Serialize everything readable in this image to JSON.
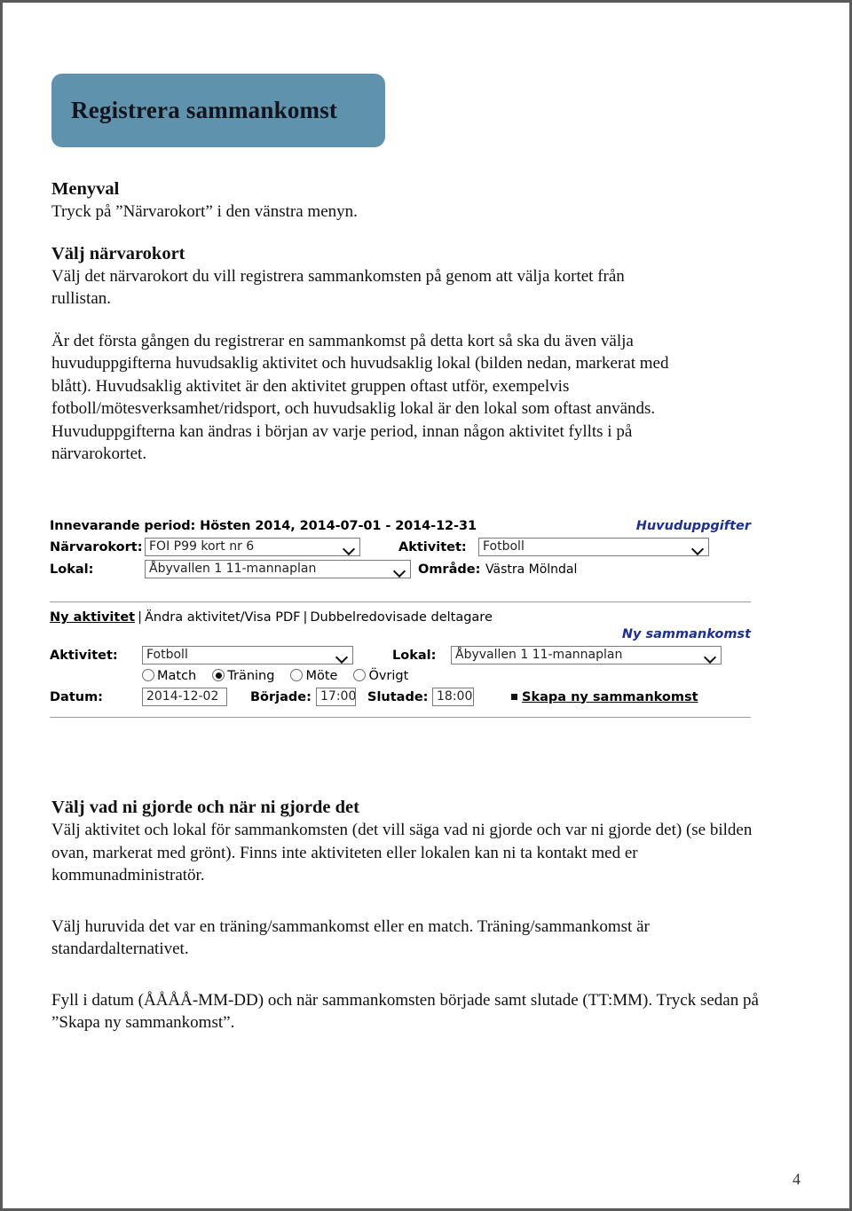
{
  "document": {
    "title_box": {
      "heading": "Registrera sammankomst",
      "bg_color": "#5f92ac"
    },
    "page_number": "4",
    "sections": [
      {
        "heading": "Menyval",
        "body": "Tryck på ”Närvarokort” i den vänstra menyn."
      },
      {
        "heading": "Välj närvarokort",
        "body": "Välj det närvarokort du vill registrera sammankomsten på genom att välja kortet från rullistan."
      }
    ],
    "intro_paragraph": "Är det första gången du registrerar en sammankomst på detta kort så ska du även välja huvuduppgifterna huvudsaklig aktivitet och huvudsaklig lokal (bilden nedan, markerat med blått). Huvudsaklig aktivitet är den aktivitet gruppen oftast utför, exempelvis fotboll/mötesverksamhet/ridsport, och huvudsaklig lokal är den lokal som oftast används. Huvuduppgifterna kan ändras i början av varje period, innan någon aktivitet fyllts i på närvarokortet.",
    "closing": {
      "heading": "Välj vad ni gjorde och när ni gjorde det",
      "paragraph1": "Välj aktivitet och lokal för sammankomsten (det vill säga vad ni gjorde och var ni gjorde det) (se bilden ovan, markerat med grönt). Finns inte aktiviteten eller lokalen kan ni ta kontakt med er kommunadministratör.",
      "paragraph2": "Välj huruvida det var en träning/sammankomst eller en match. Träning/sammankomst är standardalternativet.",
      "paragraph3": "Fyll i datum (ÅÅÅÅ-MM-DD) och när sammankomsten började samt slutade (TT:MM). Tryck sedan på ”Skapa ny sammankomst”."
    }
  },
  "screenshot": {
    "period_label": "Innevarande period: Hösten 2014, 2014-07-01 - 2014-12-31",
    "huvuduppgifter_link": "Huvuduppgifter",
    "link_color": "#1d2f8f",
    "fields": {
      "narvarokort_label": "Närvarokort:",
      "narvarokort_value": "FOI P99 kort nr 6",
      "aktivitet_label_top": "Aktivitet:",
      "aktivitet_value_top": "Fotboll",
      "lokal_label_top": "Lokal:",
      "lokal_value_top": "Åbyvallen 1 11-mannaplan",
      "omrade_label": "Område:",
      "omrade_value": "Västra Mölndal"
    },
    "toolbar": {
      "item1": "Ny aktivitet",
      "sep": "|",
      "item2": "Ändra aktivitet/Visa PDF",
      "item3": "Dubbelredovisade deltagare"
    },
    "ny_sammankomst_link": "Ny sammankomst",
    "newform": {
      "aktivitet_label": "Aktivitet:",
      "aktivitet_value": "Fotboll",
      "lokal_label": "Lokal:",
      "lokal_value": "Åbyvallen 1 11-mannaplan",
      "radios": [
        {
          "label": "Match",
          "selected": false
        },
        {
          "label": "Träning",
          "selected": true
        },
        {
          "label": "Möte",
          "selected": false
        },
        {
          "label": "Övrigt",
          "selected": false
        }
      ],
      "datum_label": "Datum:",
      "datum_value": "2014-12-02",
      "borjade_label": "Började:",
      "borjade_value": "17:00",
      "slutade_label": "Slutade:",
      "slutade_value": "18:00",
      "create_button": "Skapa ny sammankomst"
    }
  }
}
